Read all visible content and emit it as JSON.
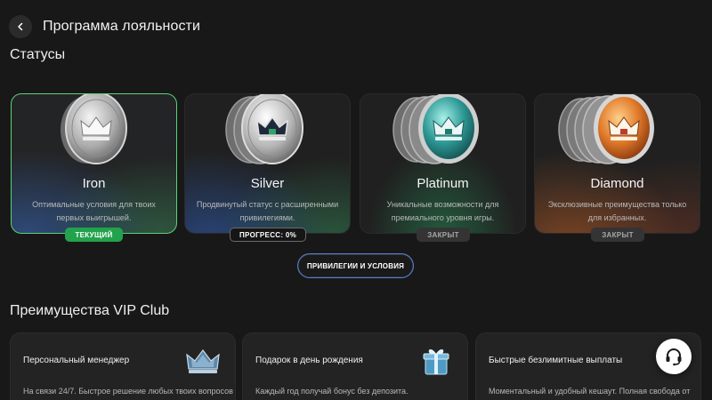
{
  "header": {
    "title": "Программа лояльности"
  },
  "statuses": {
    "title": "Статусы",
    "cards": [
      {
        "name": "Iron",
        "description": "Оптимальные условия для твоих первых выигрышей.",
        "badge": "ТЕКУЩИЙ",
        "coin_icon": "iron-coin-icon",
        "accent": "#5bd27a"
      },
      {
        "name": "Silver",
        "description": "Продвинутый статус с расширенными привилегиями.",
        "badge": "ПРОГРЕСС: 0%",
        "progress_percent": 0,
        "coin_icon": "silver-coin-icon",
        "accent": "#4a7bd8"
      },
      {
        "name": "Platinum",
        "description": "Уникальные возможности для премиального уровня игры.",
        "badge": "ЗАКРЫТ",
        "coin_icon": "platinum-coin-icon",
        "accent": "#2fb5a7"
      },
      {
        "name": "Diamond",
        "description": "Эксклюзивные преимущества только для избранных.",
        "badge": "ЗАКРЫТ",
        "coin_icon": "diamond-coin-icon",
        "accent": "#e5793a"
      }
    ],
    "privileges_button": "ПРИВИЛЕГИИ И УСЛОВИЯ"
  },
  "vip": {
    "title": "Преимущества VIP Club",
    "cards": [
      {
        "title": "Персональный менеджер",
        "description": "На связи 24/7. Быстрое решение любых твоих вопросов",
        "icon": "crown-icon"
      },
      {
        "title": "Подарок в день рождения",
        "description": "Каждый год получай бонус без депозита.",
        "icon": "gift-icon"
      },
      {
        "title": "Быстрые безлимитные выплаты",
        "description": "Моментальный и удобный кешаут. Полная свобода от",
        "icon": "payout-icon"
      }
    ]
  },
  "support": {
    "icon": "headset-icon"
  }
}
